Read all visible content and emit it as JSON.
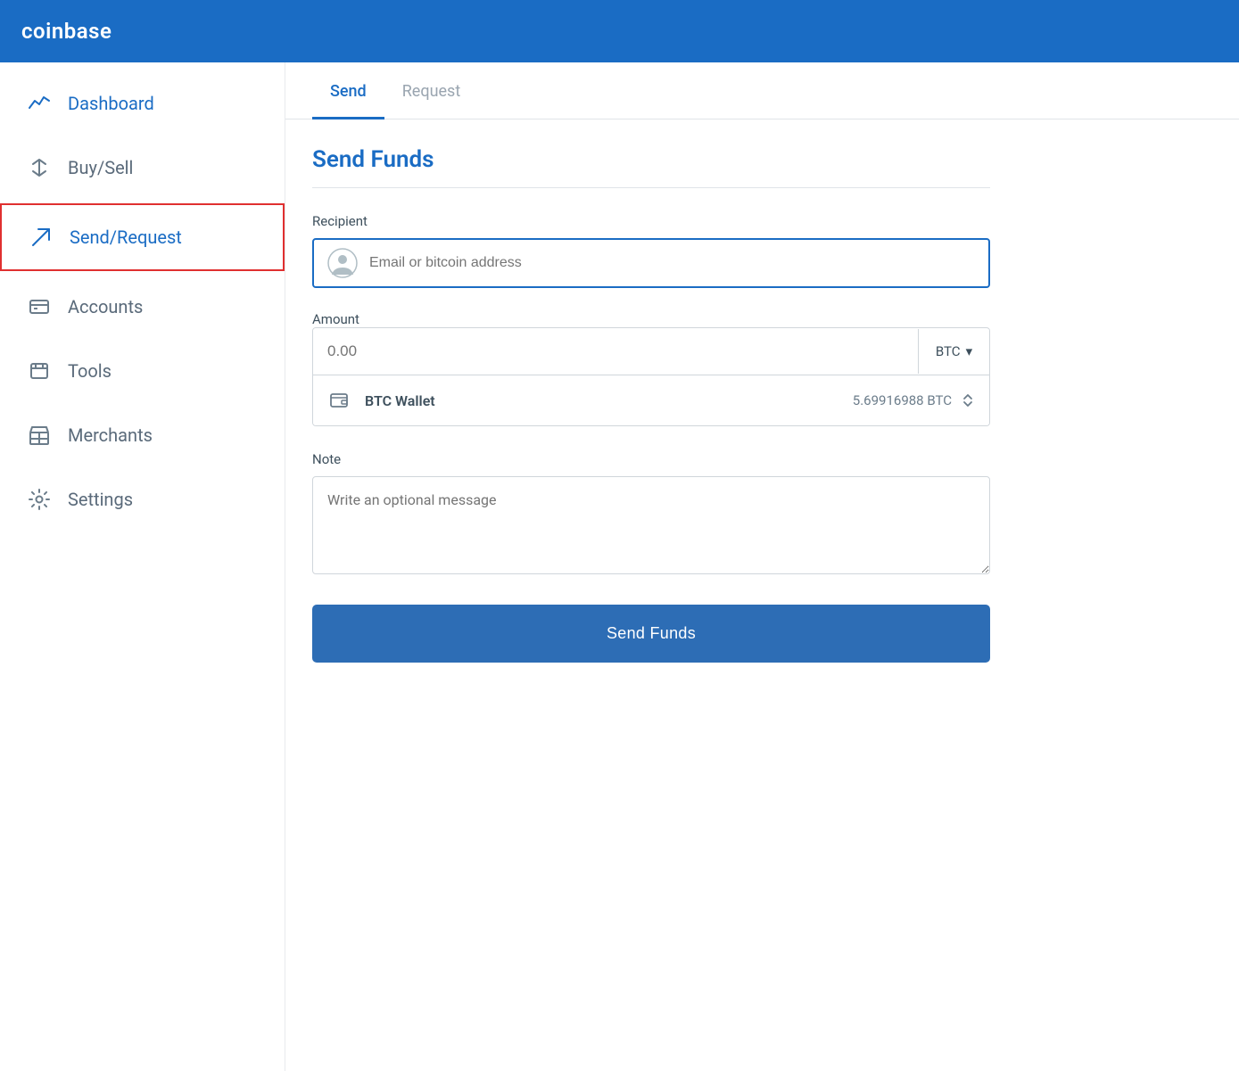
{
  "header": {
    "logo": "coinbase"
  },
  "sidebar": {
    "items": [
      {
        "id": "dashboard",
        "label": "Dashboard",
        "icon": "dashboard-icon",
        "active": true
      },
      {
        "id": "buysell",
        "label": "Buy/Sell",
        "icon": "buysell-icon",
        "active": false
      },
      {
        "id": "sendrequest",
        "label": "Send/Request",
        "icon": "send-icon",
        "active": true,
        "selected": true
      },
      {
        "id": "accounts",
        "label": "Accounts",
        "icon": "accounts-icon",
        "active": false
      },
      {
        "id": "tools",
        "label": "Tools",
        "icon": "tools-icon",
        "active": false
      },
      {
        "id": "merchants",
        "label": "Merchants",
        "icon": "merchants-icon",
        "active": false
      },
      {
        "id": "settings",
        "label": "Settings",
        "icon": "settings-icon",
        "active": false
      }
    ]
  },
  "tabs": {
    "items": [
      {
        "id": "send",
        "label": "Send",
        "active": true
      },
      {
        "id": "request",
        "label": "Request",
        "active": false
      }
    ]
  },
  "form": {
    "title": "Send Funds",
    "recipient_label": "Recipient",
    "recipient_placeholder": "Email or bitcoin address",
    "amount_label": "Amount",
    "amount_placeholder": "0.00",
    "currency": "BTC",
    "currency_symbol": "▼",
    "wallet_name": "BTC Wallet",
    "wallet_balance": "5.69916988 BTC",
    "note_label": "Note",
    "note_placeholder": "Write an optional message",
    "send_button_label": "Send Funds"
  }
}
